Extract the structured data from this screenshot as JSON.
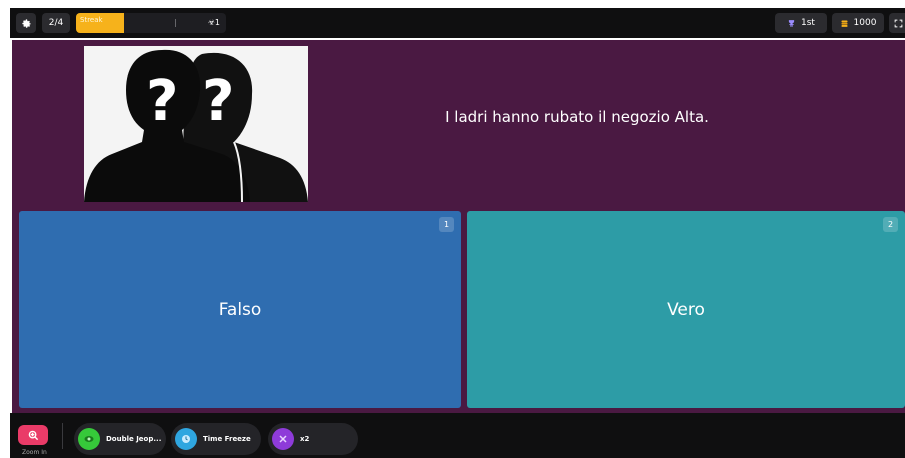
{
  "topbar": {
    "question_counter": "2/4",
    "streak_label": "Streak",
    "streak_count": "☣1",
    "rank": "1st",
    "coins": "1000"
  },
  "question": {
    "text": "I ladri hanno rubato il negozio Alta."
  },
  "answers": [
    {
      "number": "1",
      "label": "Falso",
      "color": "#2f6db0"
    },
    {
      "number": "2",
      "label": "Vero",
      "color": "#2d9ca6"
    }
  ],
  "bottombar": {
    "zoom_label": "Zoom In",
    "powerups": [
      {
        "label": "Double Jeop...",
        "icon": "double-jeopardy-icon",
        "color": "#36c93a"
      },
      {
        "label": "Time Freeze",
        "icon": "time-freeze-icon",
        "color": "#2fa6e0"
      },
      {
        "label": "x2",
        "icon": "multiplier-icon",
        "color": "#8e3bd9"
      }
    ]
  },
  "colors": {
    "panel": "#4a1942",
    "bar": "#0f0f10",
    "streak": "#f6b21b",
    "zoom": "#ea3b68"
  }
}
